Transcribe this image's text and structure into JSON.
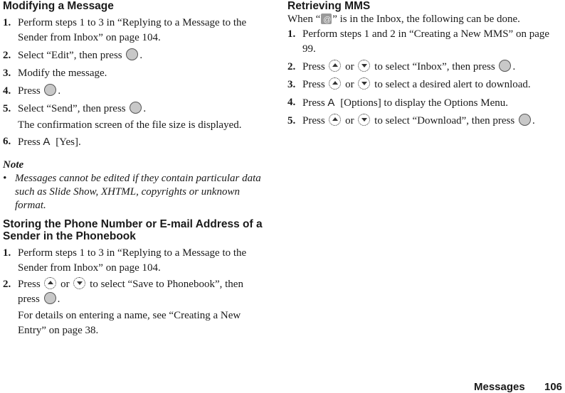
{
  "left": {
    "section1": {
      "title": "Modifying a Message",
      "steps": [
        {
          "num": "1.",
          "text": "Perform steps 1 to 3 in “Replying to a Message to the Sender from Inbox” on page 104."
        },
        {
          "num": "2.",
          "pre": "Select “Edit”, then press",
          "post": "."
        },
        {
          "num": "3.",
          "text": "Modify the message."
        },
        {
          "num": "4.",
          "pre": "Press",
          "post": "."
        },
        {
          "num": "5.",
          "pre": "Select “Send”, then press",
          "post": ".",
          "sub": "The confirmation screen of the file size is displayed."
        },
        {
          "num": "6.",
          "pre": "Press",
          "softkey": "A",
          "post": "[Yes]."
        }
      ]
    },
    "note": {
      "title": "Note",
      "bullet": "•",
      "text": "Messages cannot be edited if they contain particular data such as Slide Show, XHTML, copyrights or unknown format."
    },
    "section2": {
      "title": "Storing the Phone Number or E-mail Address of a Sender in the Phonebook",
      "steps": [
        {
          "num": "1.",
          "text": "Perform steps 1 to 3 in “Replying to a Message to the Sender from Inbox” on page 104."
        },
        {
          "num": "2.",
          "pre": "Press",
          "or": "or",
          "mid": "to select “Save to Phonebook”, then press",
          "post": ".",
          "sub": "For details on entering a name, see “Creating a New Entry” on page 38."
        }
      ]
    }
  },
  "right": {
    "section3": {
      "title": "Retrieving MMS",
      "intro_pre": "When “",
      "intro_post": "” is in the Inbox, the following can be done.",
      "steps": [
        {
          "num": "1.",
          "text": "Perform steps 1 and 2 in “Creating a New MMS” on page 99."
        },
        {
          "num": "2.",
          "pre": "Press",
          "or": "or",
          "mid": "to select “Inbox”, then press",
          "post": "."
        },
        {
          "num": "3.",
          "pre": "Press",
          "or": "or",
          "mid": "to select a desired alert to download."
        },
        {
          "num": "4.",
          "pre": "Press",
          "softkey": "A",
          "post": "[Options] to display the Options Menu."
        },
        {
          "num": "5.",
          "pre": "Press",
          "or": "or",
          "mid": "to select “Download”, then press",
          "post": "."
        }
      ]
    }
  },
  "footer": {
    "section": "Messages",
    "page": "106"
  }
}
